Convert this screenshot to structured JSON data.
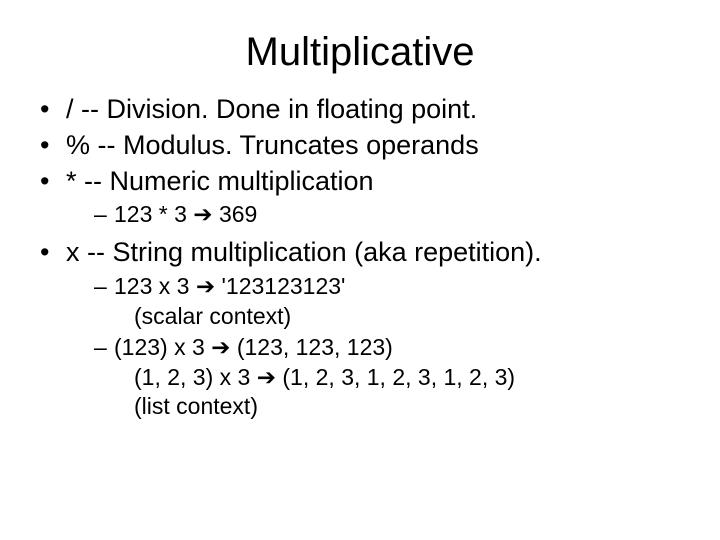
{
  "title": "Multiplicative",
  "bullets": {
    "b1": "/   -- Division.  Done in floating point.",
    "b2": "% -- Modulus.  Truncates operands",
    "b3": "*  -- Numeric multiplication",
    "b3_sub1_pre": "123 * 3 ",
    "b3_sub1_post": " 369",
    "b4": "x  -- String multiplication (aka repetition).",
    "b4_sub1_pre": "123 x 3  ",
    "b4_sub1_post": " '123123123'",
    "b4_sub1_line2": "(scalar context)",
    "b4_sub2_pre": "(123) x 3 ",
    "b4_sub2_post": " (123, 123, 123)",
    "b4_sub2_line2_pre": "(1, 2, 3) x 3 ",
    "b4_sub2_line2_post": " (1, 2, 3, 1, 2, 3, 1, 2, 3)",
    "b4_sub2_line3": "(list context)"
  },
  "arrow": "➔"
}
